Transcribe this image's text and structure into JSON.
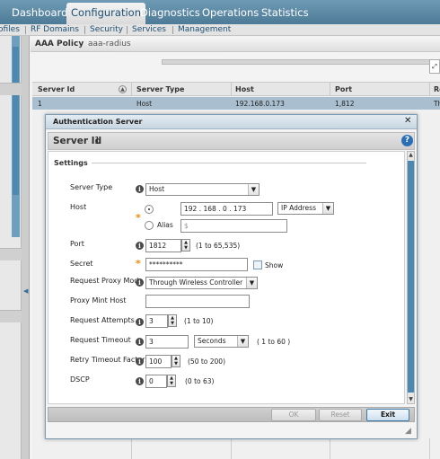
{
  "top_nav": {
    "tabs": [
      "Dashboard",
      "Configuration",
      "Diagnostics",
      "Operations",
      "Statistics"
    ],
    "active": "Configuration"
  },
  "sub_nav": {
    "items": [
      "ofiles",
      "RF Domains",
      "Security",
      "Services",
      "Management"
    ]
  },
  "policy": {
    "title": "AAA Policy",
    "name": "aaa-radius"
  },
  "grid": {
    "columns": [
      "Server Id",
      "Server Type",
      "Host",
      "Port",
      "Re"
    ],
    "rows": [
      [
        "1",
        "Host",
        "192.168.0.173",
        "1,812",
        "Th"
      ]
    ]
  },
  "dialog": {
    "title": "Authentication Server",
    "server_id_label": "Server Id",
    "server_id_value": "1",
    "section": "Settings",
    "server_type": {
      "label": "Server Type",
      "value": "Host"
    },
    "host": {
      "label": "Host",
      "ip_octets": [
        "192",
        "168",
        "0",
        "173"
      ],
      "ip_type": "IP Address",
      "alias_label": "Alias",
      "alias_placeholder": "$"
    },
    "port": {
      "label": "Port",
      "value": "1812",
      "range": "(1 to 65,535)"
    },
    "secret": {
      "label": "Secret",
      "value": "**********",
      "show_label": "Show",
      "show_checked": false
    },
    "request_proxy_mode": {
      "label": "Request Proxy Mode",
      "value": "Through Wireless Controller"
    },
    "proxy_mint_host": {
      "label": "Proxy Mint Host",
      "value": ""
    },
    "request_attempts": {
      "label": "Request Attempts",
      "value": "3",
      "range": "(1 to 10)"
    },
    "request_timeout": {
      "label": "Request Timeout",
      "value": "3",
      "unit": "Seconds",
      "range": "( 1 to 60 )"
    },
    "retry_timeout_factor": {
      "label": "Retry Timeout Factor",
      "value": "100",
      "range": "(50 to 200)"
    },
    "dscp": {
      "label": "DSCP",
      "value": "0",
      "range": "(0 to 63)"
    },
    "buttons": {
      "ok": "OK",
      "reset": "Reset",
      "exit": "Exit"
    }
  },
  "icons": {
    "info": "info-icon",
    "help": "help-icon",
    "close": "close-icon",
    "required": "required-star-icon"
  },
  "colors": {
    "nav_bar": "#5a87a3",
    "accent_blue": "#2a6fb6",
    "required_star": "#f08a00",
    "selected_row": "#a9bfcf"
  }
}
